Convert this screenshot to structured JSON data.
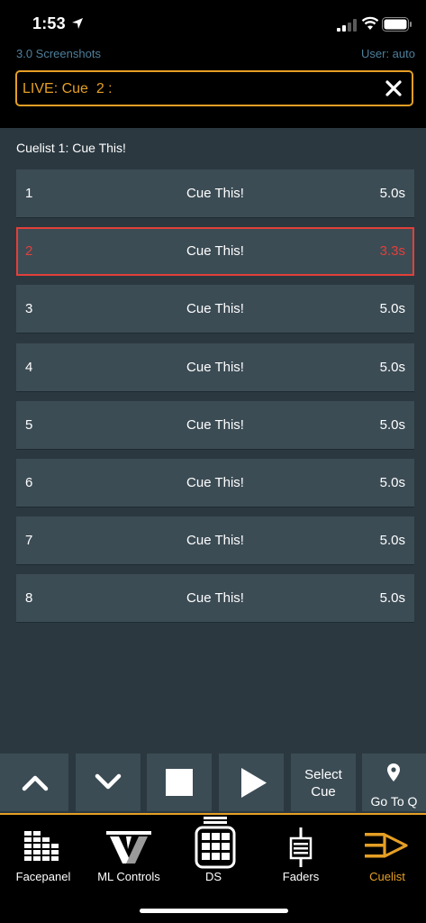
{
  "status_bar": {
    "time": "1:53"
  },
  "header": {
    "show_name": "3.0 Screenshots",
    "user_label": "User: auto",
    "live_text": "LIVE: Cue  2 :"
  },
  "cuelist": {
    "title": "Cuelist 1: Cue This!",
    "active_index": 1,
    "cues": [
      {
        "number": "1",
        "name": "Cue This!",
        "time": "5.0s"
      },
      {
        "number": "2",
        "name": "Cue This!",
        "time": "3.3s"
      },
      {
        "number": "3",
        "name": "Cue This!",
        "time": "5.0s"
      },
      {
        "number": "4",
        "name": "Cue This!",
        "time": "5.0s"
      },
      {
        "number": "5",
        "name": "Cue This!",
        "time": "5.0s"
      },
      {
        "number": "6",
        "name": "Cue This!",
        "time": "5.0s"
      },
      {
        "number": "7",
        "name": "Cue This!",
        "time": "5.0s"
      },
      {
        "number": "8",
        "name": "Cue This!",
        "time": "5.0s"
      }
    ]
  },
  "controls": {
    "up_icon": "chevron-up-icon",
    "down_icon": "chevron-down-icon",
    "stop_icon": "stop-icon",
    "play_icon": "play-icon",
    "select_cue_line1": "Select",
    "select_cue_line2": "Cue",
    "go_to_q_label": "Go To Q",
    "go_to_q_icon": "location-pin-icon"
  },
  "tabs": [
    {
      "label": "Facepanel",
      "icon": "facepanel-icon"
    },
    {
      "label": "ML Controls",
      "icon": "ml-controls-icon"
    },
    {
      "label": "DS",
      "icon": "ds-grid-icon"
    },
    {
      "label": "Faders",
      "icon": "faders-icon"
    },
    {
      "label": "Cuelist",
      "icon": "cuelist-icon",
      "selected": true
    }
  ],
  "colors": {
    "accent_orange": "#e59f25",
    "active_red": "#e33f3a",
    "row_bg": "#3c4c55",
    "page_bg": "#2b3840",
    "header_blue_text": "#4e7f9b"
  }
}
